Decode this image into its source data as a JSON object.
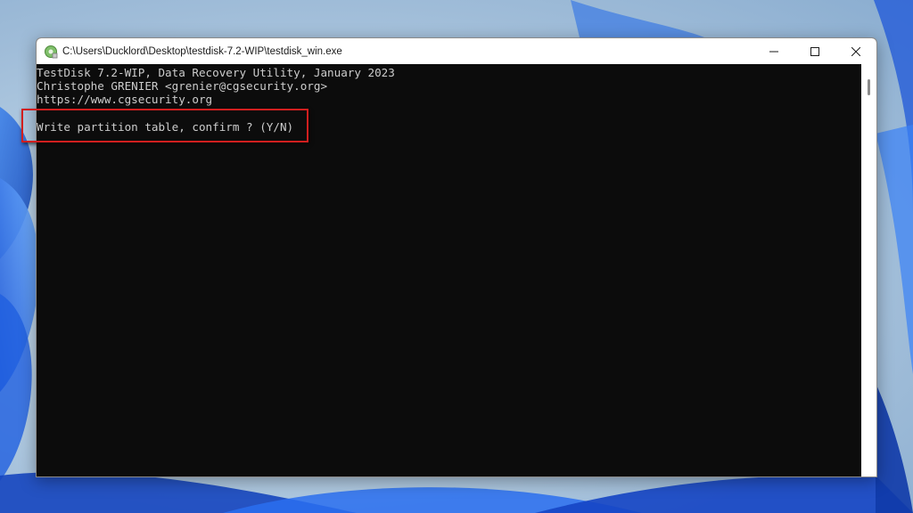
{
  "window": {
    "title": "C:\\Users\\Ducklord\\Desktop\\testdisk-7.2-WIP\\testdisk_win.exe",
    "app_icon": "testdisk-app-icon",
    "buttons": {
      "minimize": "minimize-icon",
      "maximize": "maximize-icon",
      "close": "close-icon"
    }
  },
  "console": {
    "lines": [
      "TestDisk 7.2-WIP, Data Recovery Utility, January 2023",
      "Christophe GRENIER <grenier@cgsecurity.org>",
      "https://www.cgsecurity.org"
    ],
    "prompt": "Write partition table, confirm ? (Y/N)"
  },
  "colors": {
    "console_background": "#0c0c0c",
    "console_text": "#cccccc",
    "highlight_border": "#d11f1f",
    "desktop_accent": "#1a5fd8"
  }
}
